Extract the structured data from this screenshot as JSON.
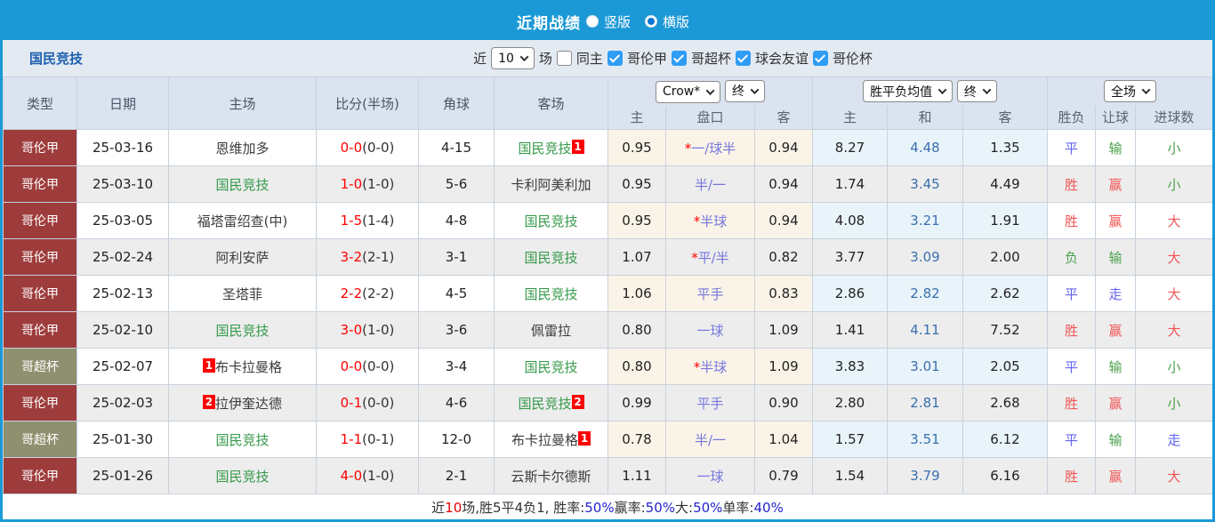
{
  "header": {
    "title": "近期战绩",
    "radio_vertical_label": "竖版",
    "radio_horizontal_label": "横版",
    "selected_layout": "横版"
  },
  "filter_bar": {
    "team_name": "国民竞技",
    "near_label": "近",
    "near_value": "10",
    "games_label": "场",
    "same_home_label": "同主",
    "same_home_checked": false,
    "leagues": [
      {
        "label": "哥伦甲",
        "checked": true
      },
      {
        "label": "哥超杯",
        "checked": true
      },
      {
        "label": "球会友谊",
        "checked": true
      },
      {
        "label": "哥伦杯",
        "checked": true
      }
    ]
  },
  "table": {
    "selects": {
      "odds_company": "Crow*",
      "odds_time": "终",
      "avg_source": "胜平负均值",
      "avg_time": "终",
      "result_scope": "全场"
    },
    "main_cols": [
      "类型",
      "日期",
      "主场",
      "比分(半场)",
      "角球",
      "客场"
    ],
    "sub_cols": [
      "主",
      "盘口",
      "客",
      "主",
      "和",
      "客",
      "胜负",
      "让球",
      "进球数"
    ],
    "rows": [
      {
        "league": "哥伦甲",
        "league_style": "red",
        "date": "25-03-16",
        "home": "恩维加多",
        "home_green": false,
        "home_badge": "",
        "score": "0-0",
        "half": "(0-0)",
        "corner": "4-15",
        "away": "国民竞技",
        "away_green": true,
        "away_badge": "1",
        "odds_home": "0.95",
        "handicap_star": true,
        "handicap": "一/球半",
        "odds_away": "0.94",
        "avg_home": "8.27",
        "avg_draw": "4.48",
        "avg_away": "1.35",
        "res_wdl": "平",
        "res_wdl_color": "blue",
        "res_handicap": "输",
        "res_handicap_color": "green",
        "res_goals": "小",
        "res_goals_color": "green"
      },
      {
        "league": "哥伦甲",
        "league_style": "red",
        "date": "25-03-10",
        "home": "国民竞技",
        "home_green": true,
        "home_badge": "",
        "score": "1-0",
        "half": "(1-0)",
        "corner": "5-6",
        "away": "卡利阿美利加",
        "away_green": false,
        "away_badge": "",
        "odds_home": "0.95",
        "handicap_star": false,
        "handicap": "半/一",
        "odds_away": "0.94",
        "avg_home": "1.74",
        "avg_draw": "3.45",
        "avg_away": "4.49",
        "res_wdl": "胜",
        "res_wdl_color": "red",
        "res_handicap": "赢",
        "res_handicap_color": "red",
        "res_goals": "小",
        "res_goals_color": "green"
      },
      {
        "league": "哥伦甲",
        "league_style": "red",
        "date": "25-03-05",
        "home": "福塔雷绍查(中)",
        "home_green": false,
        "home_badge": "",
        "score": "1-5",
        "half": "(1-4)",
        "corner": "4-8",
        "away": "国民竞技",
        "away_green": true,
        "away_badge": "",
        "odds_home": "0.95",
        "handicap_star": true,
        "handicap": "半球",
        "odds_away": "0.94",
        "avg_home": "4.08",
        "avg_draw": "3.21",
        "avg_away": "1.91",
        "res_wdl": "胜",
        "res_wdl_color": "red",
        "res_handicap": "赢",
        "res_handicap_color": "red",
        "res_goals": "大",
        "res_goals_color": "red"
      },
      {
        "league": "哥伦甲",
        "league_style": "red",
        "date": "25-02-24",
        "home": "阿利安萨",
        "home_green": false,
        "home_badge": "",
        "score": "3-2",
        "half": "(2-1)",
        "corner": "3-1",
        "away": "国民竞技",
        "away_green": true,
        "away_badge": "",
        "odds_home": "1.07",
        "handicap_star": true,
        "handicap": "平/半",
        "odds_away": "0.82",
        "avg_home": "3.77",
        "avg_draw": "3.09",
        "avg_away": "2.00",
        "res_wdl": "负",
        "res_wdl_color": "green",
        "res_handicap": "输",
        "res_handicap_color": "green",
        "res_goals": "大",
        "res_goals_color": "red"
      },
      {
        "league": "哥伦甲",
        "league_style": "red",
        "date": "25-02-13",
        "home": "圣塔菲",
        "home_green": false,
        "home_badge": "",
        "score": "2-2",
        "half": "(2-2)",
        "corner": "4-5",
        "away": "国民竞技",
        "away_green": true,
        "away_badge": "",
        "odds_home": "1.06",
        "handicap_star": false,
        "handicap": "平手",
        "odds_away": "0.83",
        "avg_home": "2.86",
        "avg_draw": "2.82",
        "avg_away": "2.62",
        "res_wdl": "平",
        "res_wdl_color": "blue",
        "res_handicap": "走",
        "res_handicap_color": "blue",
        "res_goals": "大",
        "res_goals_color": "red"
      },
      {
        "league": "哥伦甲",
        "league_style": "red",
        "date": "25-02-10",
        "home": "国民竞技",
        "home_green": true,
        "home_badge": "",
        "score": "3-0",
        "half": "(1-0)",
        "corner": "3-6",
        "away": "佩雷拉",
        "away_green": false,
        "away_badge": "",
        "odds_home": "0.80",
        "handicap_star": false,
        "handicap": "一球",
        "odds_away": "1.09",
        "avg_home": "1.41",
        "avg_draw": "4.11",
        "avg_away": "7.52",
        "res_wdl": "胜",
        "res_wdl_color": "red",
        "res_handicap": "赢",
        "res_handicap_color": "red",
        "res_goals": "大",
        "res_goals_color": "red"
      },
      {
        "league": "哥超杯",
        "league_style": "olive",
        "date": "25-02-07",
        "home": "布卡拉曼格",
        "home_green": false,
        "home_badge": "1",
        "score": "0-0",
        "half": "(0-0)",
        "corner": "3-4",
        "away": "国民竞技",
        "away_green": true,
        "away_badge": "",
        "odds_home": "0.80",
        "handicap_star": true,
        "handicap": "半球",
        "odds_away": "1.09",
        "avg_home": "3.83",
        "avg_draw": "3.01",
        "avg_away": "2.05",
        "res_wdl": "平",
        "res_wdl_color": "blue",
        "res_handicap": "输",
        "res_handicap_color": "green",
        "res_goals": "小",
        "res_goals_color": "green"
      },
      {
        "league": "哥伦甲",
        "league_style": "red",
        "date": "25-02-03",
        "home": "拉伊奎达德",
        "home_green": false,
        "home_badge": "2",
        "score": "0-1",
        "half": "(0-0)",
        "corner": "4-6",
        "away": "国民竞技",
        "away_green": true,
        "away_badge": "2",
        "odds_home": "0.99",
        "handicap_star": false,
        "handicap": "平手",
        "odds_away": "0.90",
        "avg_home": "2.80",
        "avg_draw": "2.81",
        "avg_away": "2.68",
        "res_wdl": "胜",
        "res_wdl_color": "red",
        "res_handicap": "赢",
        "res_handicap_color": "red",
        "res_goals": "小",
        "res_goals_color": "green"
      },
      {
        "league": "哥超杯",
        "league_style": "olive",
        "date": "25-01-30",
        "home": "国民竞技",
        "home_green": true,
        "home_badge": "",
        "score": "1-1",
        "half": "(0-1)",
        "corner": "12-0",
        "away": "布卡拉曼格",
        "away_green": false,
        "away_badge": "1",
        "odds_home": "0.78",
        "handicap_star": false,
        "handicap": "半/一",
        "odds_away": "1.04",
        "avg_home": "1.57",
        "avg_draw": "3.51",
        "avg_away": "6.12",
        "res_wdl": "平",
        "res_wdl_color": "blue",
        "res_handicap": "输",
        "res_handicap_color": "green",
        "res_goals": "走",
        "res_goals_color": "blue"
      },
      {
        "league": "哥伦甲",
        "league_style": "red",
        "date": "25-01-26",
        "home": "国民竞技",
        "home_green": true,
        "home_badge": "",
        "score": "4-0",
        "half": "(1-0)",
        "corner": "2-1",
        "away": "云斯卡尔德斯",
        "away_green": false,
        "away_badge": "",
        "odds_home": "1.11",
        "handicap_star": false,
        "handicap": "一球",
        "odds_away": "0.79",
        "avg_home": "1.54",
        "avg_draw": "3.79",
        "avg_away": "6.16",
        "res_wdl": "胜",
        "res_wdl_color": "red",
        "res_handicap": "赢",
        "res_handicap_color": "red",
        "res_goals": "大",
        "res_goals_color": "red"
      }
    ]
  },
  "summary": {
    "segments": [
      {
        "text": "近",
        "color": "black"
      },
      {
        "text": "10",
        "color": "red"
      },
      {
        "text": "场,胜5平4负1, 胜率:",
        "color": "black"
      },
      {
        "text": "50%",
        "color": "blue"
      },
      {
        "text": " 赢率:",
        "color": "black"
      },
      {
        "text": "50%",
        "color": "blue"
      },
      {
        "text": " 大:",
        "color": "black"
      },
      {
        "text": "50%",
        "color": "blue"
      },
      {
        "text": " 单率:",
        "color": "black"
      },
      {
        "text": "40%",
        "color": "blue"
      }
    ]
  },
  "colors": {
    "brand_blue": "#1b99d6",
    "league_red": "#9e3c3c",
    "league_olive": "#8f906f",
    "score_red": "#fe0000",
    "team_green": "#349949",
    "result_red": "#f25555",
    "result_blue": "#6363f0",
    "result_green": "#4da14d",
    "summary_blue": "#2222cc"
  }
}
